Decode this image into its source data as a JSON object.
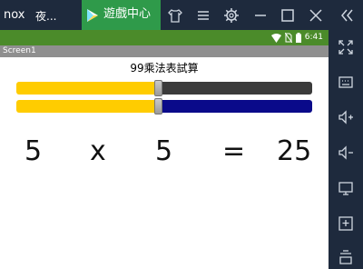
{
  "emulator": {
    "logo": "nox",
    "app_tab_label": "夜...",
    "game_center_label": "遊戲中心",
    "toolbar_icons": [
      "shirt-icon",
      "menu-icon",
      "gear-icon",
      "minimize-icon",
      "maximize-icon",
      "close-icon",
      "collapse-double-chevron-icon"
    ],
    "sidebar_icons": [
      "fullscreen-icon",
      "keyboard-icon",
      "volume-up-icon",
      "volume-down-icon",
      "screen-icon",
      "add-apk-icon",
      "install-icon"
    ],
    "colors": {
      "titlebar": "#1e2a3d",
      "game_tab": "#2f9a4a"
    }
  },
  "android": {
    "time": "6:41",
    "status_icons": [
      "wifi-icon",
      "no-sim-icon",
      "battery-icon"
    ],
    "status_bar_color": "#4b8b2a"
  },
  "app": {
    "screen_title": "Screen1",
    "heading": "99乘法表試算",
    "slider1": {
      "value_fraction": 0.48,
      "fill_color": "#ffcc00",
      "track_color": "#3b3b3b"
    },
    "slider2": {
      "value_fraction": 0.48,
      "fill_color": "#ffcc00",
      "track_color": "#0a0a8a"
    },
    "equation": {
      "a": "5",
      "op": "x",
      "b": "5",
      "eq": "=",
      "result": "25"
    }
  }
}
